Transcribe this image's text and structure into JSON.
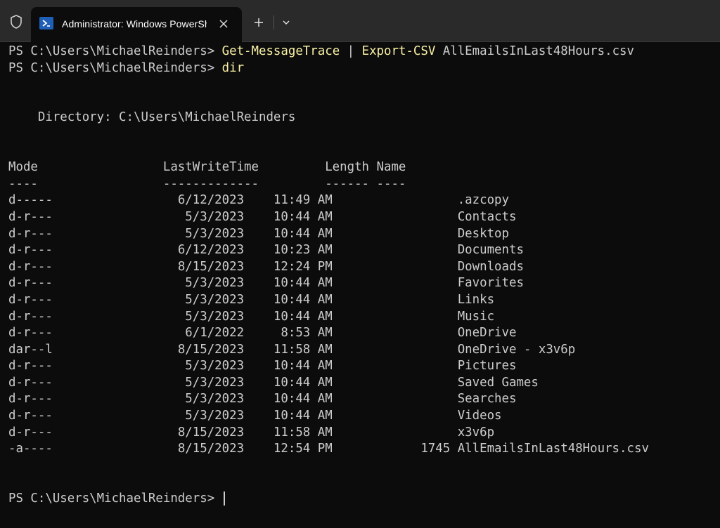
{
  "window": {
    "tab_title": "Administrator: Windows PowerShell",
    "tab_icon": "powershell-icon",
    "accent": "#1f5fb5"
  },
  "terminal": {
    "prompt": "PS C:\\Users\\MichaelReinders> ",
    "line1": {
      "cmd1": "Get-MessageTrace",
      "pipe": " | ",
      "cmd2": "Export-CSV",
      "arg": " AllEmailsInLast48Hours.csv"
    },
    "line2": {
      "cmd": "dir"
    },
    "directory_line": "    Directory: C:\\Users\\MichaelReinders",
    "header_line": "Mode                 LastWriteTime         Length Name",
    "underline_line": "----                 -------------         ------ ----",
    "rows": [
      {
        "mode": "d-----",
        "date": "6/12/2023",
        "time": "11:49 AM",
        "length": "",
        "name": ".azcopy"
      },
      {
        "mode": "d-r---",
        "date": "5/3/2023",
        "time": "10:44 AM",
        "length": "",
        "name": "Contacts"
      },
      {
        "mode": "d-r---",
        "date": "5/3/2023",
        "time": "10:44 AM",
        "length": "",
        "name": "Desktop"
      },
      {
        "mode": "d-r---",
        "date": "6/12/2023",
        "time": "10:23 AM",
        "length": "",
        "name": "Documents"
      },
      {
        "mode": "d-r---",
        "date": "8/15/2023",
        "time": "12:24 PM",
        "length": "",
        "name": "Downloads"
      },
      {
        "mode": "d-r---",
        "date": "5/3/2023",
        "time": "10:44 AM",
        "length": "",
        "name": "Favorites"
      },
      {
        "mode": "d-r---",
        "date": "5/3/2023",
        "time": "10:44 AM",
        "length": "",
        "name": "Links"
      },
      {
        "mode": "d-r---",
        "date": "5/3/2023",
        "time": "10:44 AM",
        "length": "",
        "name": "Music"
      },
      {
        "mode": "d-r---",
        "date": "6/1/2022",
        "time": "8:53 AM",
        "length": "",
        "name": "OneDrive"
      },
      {
        "mode": "dar--l",
        "date": "8/15/2023",
        "time": "11:58 AM",
        "length": "",
        "name": "OneDrive - x3v6p"
      },
      {
        "mode": "d-r---",
        "date": "5/3/2023",
        "time": "10:44 AM",
        "length": "",
        "name": "Pictures"
      },
      {
        "mode": "d-r---",
        "date": "5/3/2023",
        "time": "10:44 AM",
        "length": "",
        "name": "Saved Games"
      },
      {
        "mode": "d-r---",
        "date": "5/3/2023",
        "time": "10:44 AM",
        "length": "",
        "name": "Searches"
      },
      {
        "mode": "d-r---",
        "date": "5/3/2023",
        "time": "10:44 AM",
        "length": "",
        "name": "Videos"
      },
      {
        "mode": "d-r---",
        "date": "8/15/2023",
        "time": "11:58 AM",
        "length": "",
        "name": "x3v6p"
      },
      {
        "mode": "-a----",
        "date": "8/15/2023",
        "time": "12:54 PM",
        "length": "1745",
        "name": "AllEmailsInLast48Hours.csv"
      }
    ]
  }
}
